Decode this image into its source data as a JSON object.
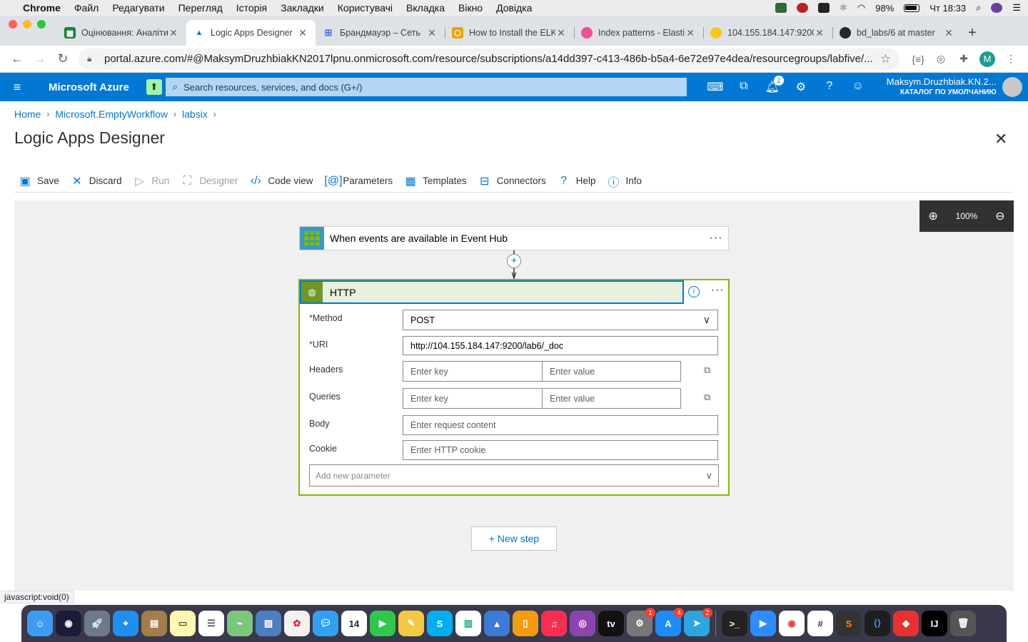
{
  "menubar": {
    "app": "Chrome",
    "items": [
      "Файл",
      "Редагувати",
      "Перегляд",
      "Історія",
      "Закладки",
      "Користувачі",
      "Вкладка",
      "Вікно",
      "Довідка"
    ],
    "battery": "98%",
    "clock": "Чт 18:33"
  },
  "tabs": [
    {
      "title": "Оцінювання: Аналіти",
      "color": "#188038"
    },
    {
      "title": "Logic Apps Designer",
      "color": "#0078d4"
    },
    {
      "title": "Брандмауэр – Сеть",
      "color": "#4a6ee0"
    },
    {
      "title": "How to Install the ELK",
      "color": "#e8a20c"
    },
    {
      "title": "Index patterns - Elastic",
      "color": "#f04e98"
    },
    {
      "title": "104.155.184.147:9200",
      "color": "#fec514"
    },
    {
      "title": "bd_labs/6 at master",
      "color": "#24292e"
    }
  ],
  "address": {
    "url": "portal.azure.com/#@MaksymDruzhbiakKN2017lpnu.onmicrosoft.com/resource/subscriptions/a14dd397-c413-486b-b5a4-6e72e97e4dea/resourcegroups/labfive/...",
    "profile_initial": "M"
  },
  "azure": {
    "brand": "Microsoft Azure",
    "search_placeholder": "Search resources, services, and docs (G+/)",
    "notifications": "2",
    "user_name": "Maksym.Druzhbiak.KN.2...",
    "user_directory": "КАТАЛОГ ПО УМОЛЧАНИЮ"
  },
  "breadcrumb": [
    "Home",
    "Microsoft.EmptyWorkflow",
    "labsix"
  ],
  "page_title": "Logic Apps Designer",
  "commands": {
    "save": "Save",
    "discard": "Discard",
    "run": "Run",
    "designer": "Designer",
    "code_view": "Code view",
    "parameters": "Parameters",
    "templates": "Templates",
    "connectors": "Connectors",
    "help": "Help",
    "info": "Info"
  },
  "zoom": "100%",
  "trigger": {
    "title": "When events are available in Event Hub"
  },
  "action": {
    "title": "HTTP",
    "method_label": "Method",
    "method_value": "POST",
    "uri_label": "URI",
    "uri_value": "http://104.155.184.147:9200/lab6/_doc",
    "headers_label": "Headers",
    "queries_label": "Queries",
    "key_placeholder": "Enter key",
    "value_placeholder": "Enter value",
    "body_label": "Body",
    "body_placeholder": "Enter request content",
    "cookie_label": "Cookie",
    "cookie_placeholder": "Enter HTTP cookie",
    "add_param_placeholder": "Add new parameter"
  },
  "new_step": "+ New step",
  "status_url": "javascript:void(0)",
  "dock_badges": {
    "settings": "1",
    "appstore": "4",
    "telegram": "2"
  }
}
